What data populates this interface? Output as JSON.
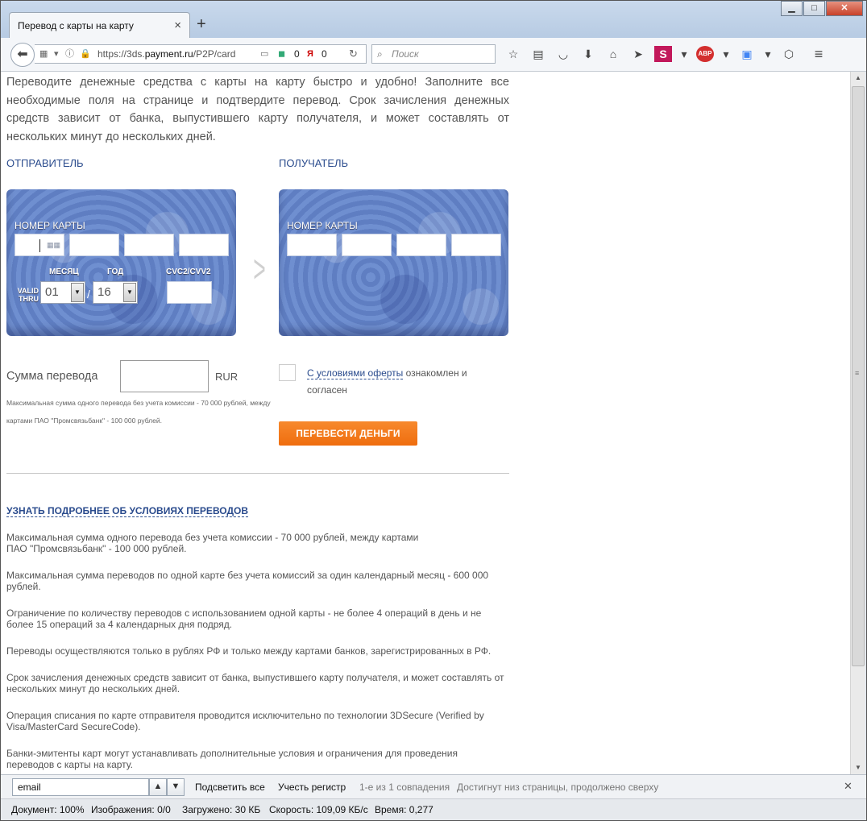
{
  "browser": {
    "tab_title": "Перевод с карты на карту",
    "tab_close": "×",
    "new_tab": "+",
    "window_buttons": {
      "minimize": "▁",
      "maximize": "□",
      "close": "✕"
    },
    "url_prefix": "https://3ds.",
    "url_domain": "payment.ru",
    "url_path": "/P2P/card",
    "counter_google": "0",
    "counter_yandex": "0",
    "search_placeholder": "Поиск"
  },
  "page": {
    "intro": "Переводите денежные средства с карты на карту быстро и удобно! Заполните все необходимые поля на странице и подтвердите перевод. Срок зачисления денежных средств зависит от банка, выпустившего карту получателя, и может составлять от нескольких минут до нескольких дней.",
    "sender_title": "ОТПРАВИТЕЛЬ",
    "recipient_title": "ПОЛУЧАТЕЛЬ",
    "card_number_label": "НОМЕР КАРТЫ",
    "month_label": "МЕСЯЦ",
    "year_label": "ГОД",
    "cvc_label": "CVC2/CVV2",
    "valid_thru": "VALID THRU",
    "month_value": "01",
    "year_value": "16",
    "amount_label": "Сумма перевода",
    "currency": "RUR",
    "amount_note": "Максимальная сумма одного перевода без учета комиссии - 70 000 рублей, между картами ПАО \"Промсвязьбанк\" - 100 000 рублей.",
    "consent_link": "С условиями оферты",
    "consent_rest": " ознакомлен и согласен",
    "submit_label": "ПЕРЕВЕСТИ ДЕНЬГИ",
    "more_link": "УЗНАТЬ ПОДРОБНЕЕ ОБ УСЛОВИЯХ ПЕРЕВОДОВ",
    "rules": [
      "Максимальная сумма одного перевода без учета комиссии - 70 000 рублей, между картами ПАО \"Промсвязьбанк\" - 100 000 рублей.",
      "Максимальная сумма переводов по одной карте без учета комиссий за один календарный месяц - 600 000 рублей.",
      "Ограничение по количеству переводов с использованием одной карты - не более 4 операций в день и не более 15 операций за 4 календарных дня подряд.",
      "Переводы осуществляются только в рублях РФ и только между картами банков, зарегистрированных в РФ.",
      "Срок зачисления денежных средств зависит от банка, выпустившего карту получателя, и может составлять от нескольких минут до нескольких дней.",
      "Операция списания по карте отправителя проводится исключительно по технологии 3DSecure (Verified by Visa/MasterCard SecureCode).",
      "Банки-эмитенты карт могут устанавливать дополнительные условия и ограничения для проведения переводов с карты на карту."
    ]
  },
  "findbar": {
    "query": "email",
    "highlight_all": "Подсветить все",
    "match_case": "Учесть регистр",
    "match_count": "1-е из 1 совпадения",
    "wrap_notice": "Достигнут низ страницы, продолжено сверху",
    "close": "✕"
  },
  "statusbar": {
    "document": "Документ: 100%",
    "images": "Изображения: 0/0",
    "loaded": "Загружено: 30 КБ",
    "speed": "Скорость: 109,09 КБ/с",
    "time": "Время: 0,277"
  },
  "colors": {
    "link": "#2a4b8d",
    "button": "#f07a1e",
    "card": "#6d8dcf"
  },
  "icons": [
    "back-icon",
    "info-icon",
    "lock-icon",
    "reader-icon",
    "google-icon",
    "yandex-icon",
    "reload-icon",
    "search-icon",
    "star-icon",
    "bookmarks-icon",
    "pocket-icon",
    "download-icon",
    "home-icon",
    "send-icon",
    "s-icon",
    "abp-icon",
    "translate-icon",
    "menu-icon",
    "keyboard-icon"
  ]
}
